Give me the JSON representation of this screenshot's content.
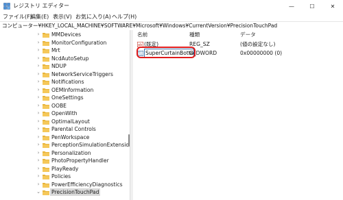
{
  "window": {
    "title": "レジストリ エディター",
    "minimize": "—",
    "maximize": "☐",
    "close": "✕"
  },
  "menu": [
    "ファイル(F)",
    "編集(E)",
    "表示(V)",
    "お気に入り(A)",
    "ヘルプ(H)"
  ],
  "address": "コンピューター¥HKEY_LOCAL_MACHINE¥SOFTWARE¥Microsoft¥Windows¥CurrentVersion¥PrecisionTouchPad",
  "tree": {
    "items": [
      {
        "label": "MMDevices",
        "expanded": false
      },
      {
        "label": "MonitorConfiguration",
        "expanded": false
      },
      {
        "label": "Mrt",
        "expanded": false
      },
      {
        "label": "NcdAutoSetup",
        "expanded": false
      },
      {
        "label": "NDUP",
        "expanded": false
      },
      {
        "label": "NetworkServiceTriggers",
        "expanded": false
      },
      {
        "label": "Notifications",
        "expanded": false
      },
      {
        "label": "OEMInformation",
        "expanded": false
      },
      {
        "label": "OneSettings",
        "expanded": false
      },
      {
        "label": "OOBE",
        "expanded": false
      },
      {
        "label": "OpenWith",
        "expanded": false
      },
      {
        "label": "OptimalLayout",
        "expanded": false
      },
      {
        "label": "Parental Controls",
        "expanded": false
      },
      {
        "label": "PenWorkspace",
        "expanded": false
      },
      {
        "label": "PerceptionSimulationExtensions",
        "expanded": false
      },
      {
        "label": "Personalization",
        "expanded": false
      },
      {
        "label": "PhotoPropertyHandler",
        "expanded": false
      },
      {
        "label": "PlayReady",
        "expanded": false
      },
      {
        "label": "Policies",
        "expanded": false
      },
      {
        "label": "PowerEfficiencyDiagnostics",
        "expanded": false
      },
      {
        "label": "PrecisionTouchPad",
        "expanded": true,
        "selected": true
      }
    ]
  },
  "list": {
    "columns": [
      "名前",
      "種類",
      "データ"
    ],
    "rows": [
      {
        "name": "(既定)",
        "type": "REG_SZ",
        "data": "(値の設定なし)"
      },
      {
        "name": "SuperCurtainBottom",
        "type": "G_DWORD",
        "data": "0x00000000 (0)",
        "editing": true
      }
    ]
  },
  "colors": {
    "highlight": "#e01b1b",
    "folder": "#e8b43a",
    "selection": "#d9d9d9"
  },
  "icons": {
    "app": "registry-editor-icon",
    "folder": "folder-icon",
    "chevron": "chevron-right-icon",
    "string_value": "reg-sz-icon",
    "binary_value": "reg-dword-icon"
  }
}
